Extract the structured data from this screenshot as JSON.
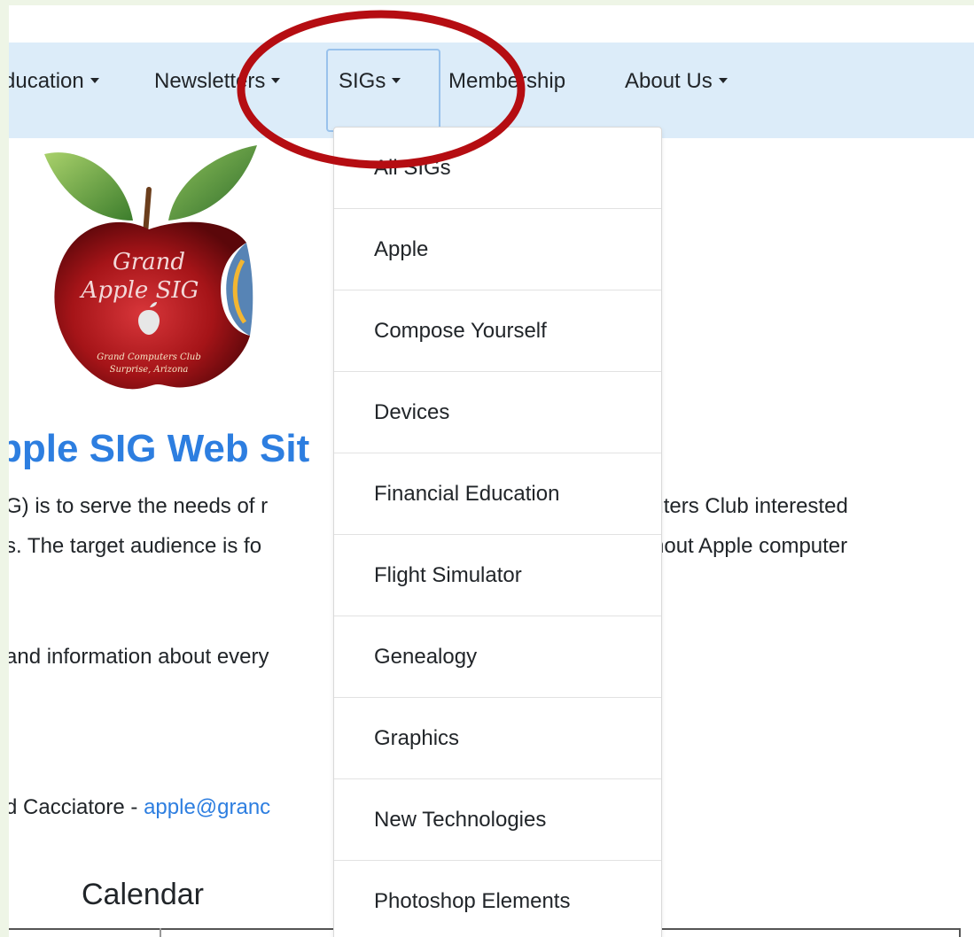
{
  "navbar": {
    "items": [
      {
        "label": "ducation",
        "has_caret": true
      },
      {
        "label": "Newsletters",
        "has_caret": true
      },
      {
        "label": "SIGs",
        "has_caret": true,
        "active": true
      },
      {
        "label": "Membership",
        "has_caret": false
      },
      {
        "label": "About Us",
        "has_caret": true
      }
    ]
  },
  "logo": {
    "title_line1": "Grand",
    "title_line2": "Apple SIG",
    "club_line1": "Grand Computers Club",
    "club_line2": "Surprise, Arizona"
  },
  "main": {
    "heading": "pple SIG Web Sit",
    "para1_line1": "G) is to serve the needs of r",
    "para1_line1_right": "puters Club interested",
    "para1_line2": "s. The target audience is fo",
    "para1_line2_right": "hout Apple computer",
    "para2": "and information about every",
    "contact_text": "d Cacciatore - ",
    "contact_link": "apple@granc",
    "calendar_title": "Calendar"
  },
  "dropdown": {
    "items": [
      "All SIGs",
      "Apple",
      "Compose Yourself",
      "Devices",
      "Financial Education",
      "Flight Simulator",
      "Genealogy",
      "Graphics",
      "New Technologies",
      "Photoshop Elements"
    ]
  },
  "colors": {
    "navbar_bg": "#dcecf9",
    "heading": "#2d7ee0",
    "annotation_circle": "#b50d12",
    "outer_bg": "#eef5e6"
  }
}
